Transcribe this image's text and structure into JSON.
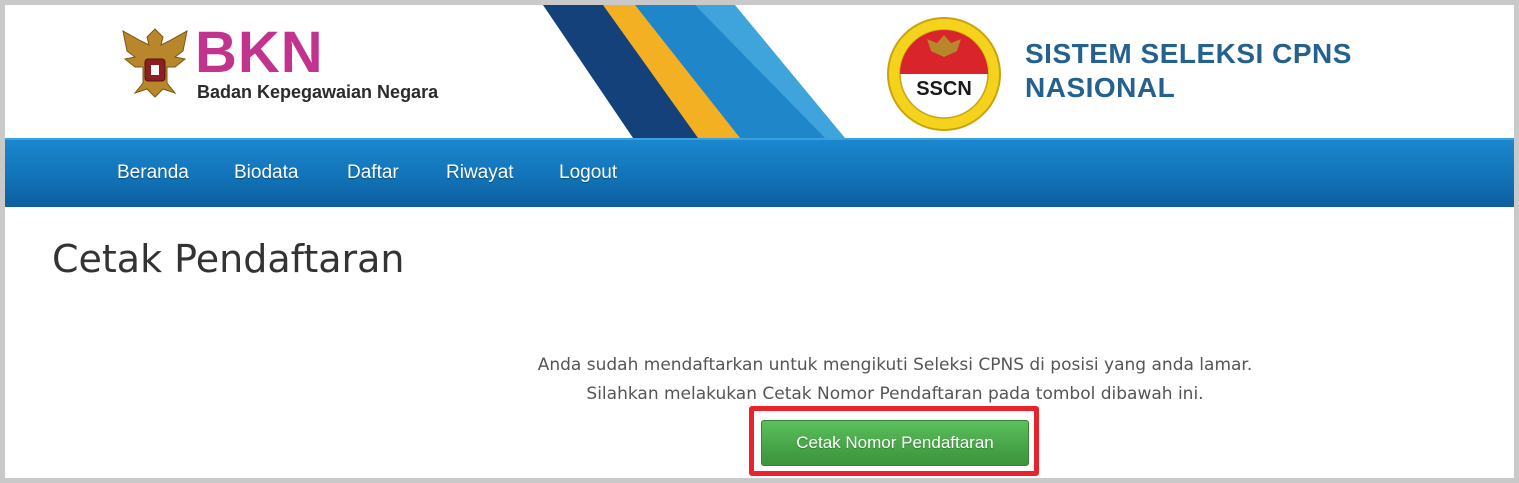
{
  "header": {
    "bkn_logo_text": "BKN",
    "bkn_subtitle": "Badan Kepegawaian Negara",
    "sscn_seal_text": "SSCN",
    "sscn_title_line1": "SISTEM SELEKSI CPNS",
    "sscn_title_line2": "NASIONAL",
    "icons": [
      "garuda-emblem-icon",
      "sscn-seal-icon"
    ]
  },
  "nav": {
    "items": [
      {
        "label": "Beranda"
      },
      {
        "label": "Biodata"
      },
      {
        "label": "Daftar"
      },
      {
        "label": "Riwayat"
      },
      {
        "label": "Logout"
      }
    ]
  },
  "main": {
    "page_title": "Cetak Pendaftaran",
    "message_line1": "Anda sudah mendaftarkan untuk mengikuti Seleksi CPNS di posisi yang anda lamar.",
    "message_line2": "Silahkan melakukan Cetak Nomor Pendaftaran pada tombol dibawah ini.",
    "print_button_label": "Cetak Nomor Pendaftaran"
  },
  "colors": {
    "brand_magenta": "#c2338e",
    "nav_blue": "#1273b8",
    "title_blue": "#24618e",
    "button_green": "#47a447",
    "highlight_red": "#e8232b"
  }
}
